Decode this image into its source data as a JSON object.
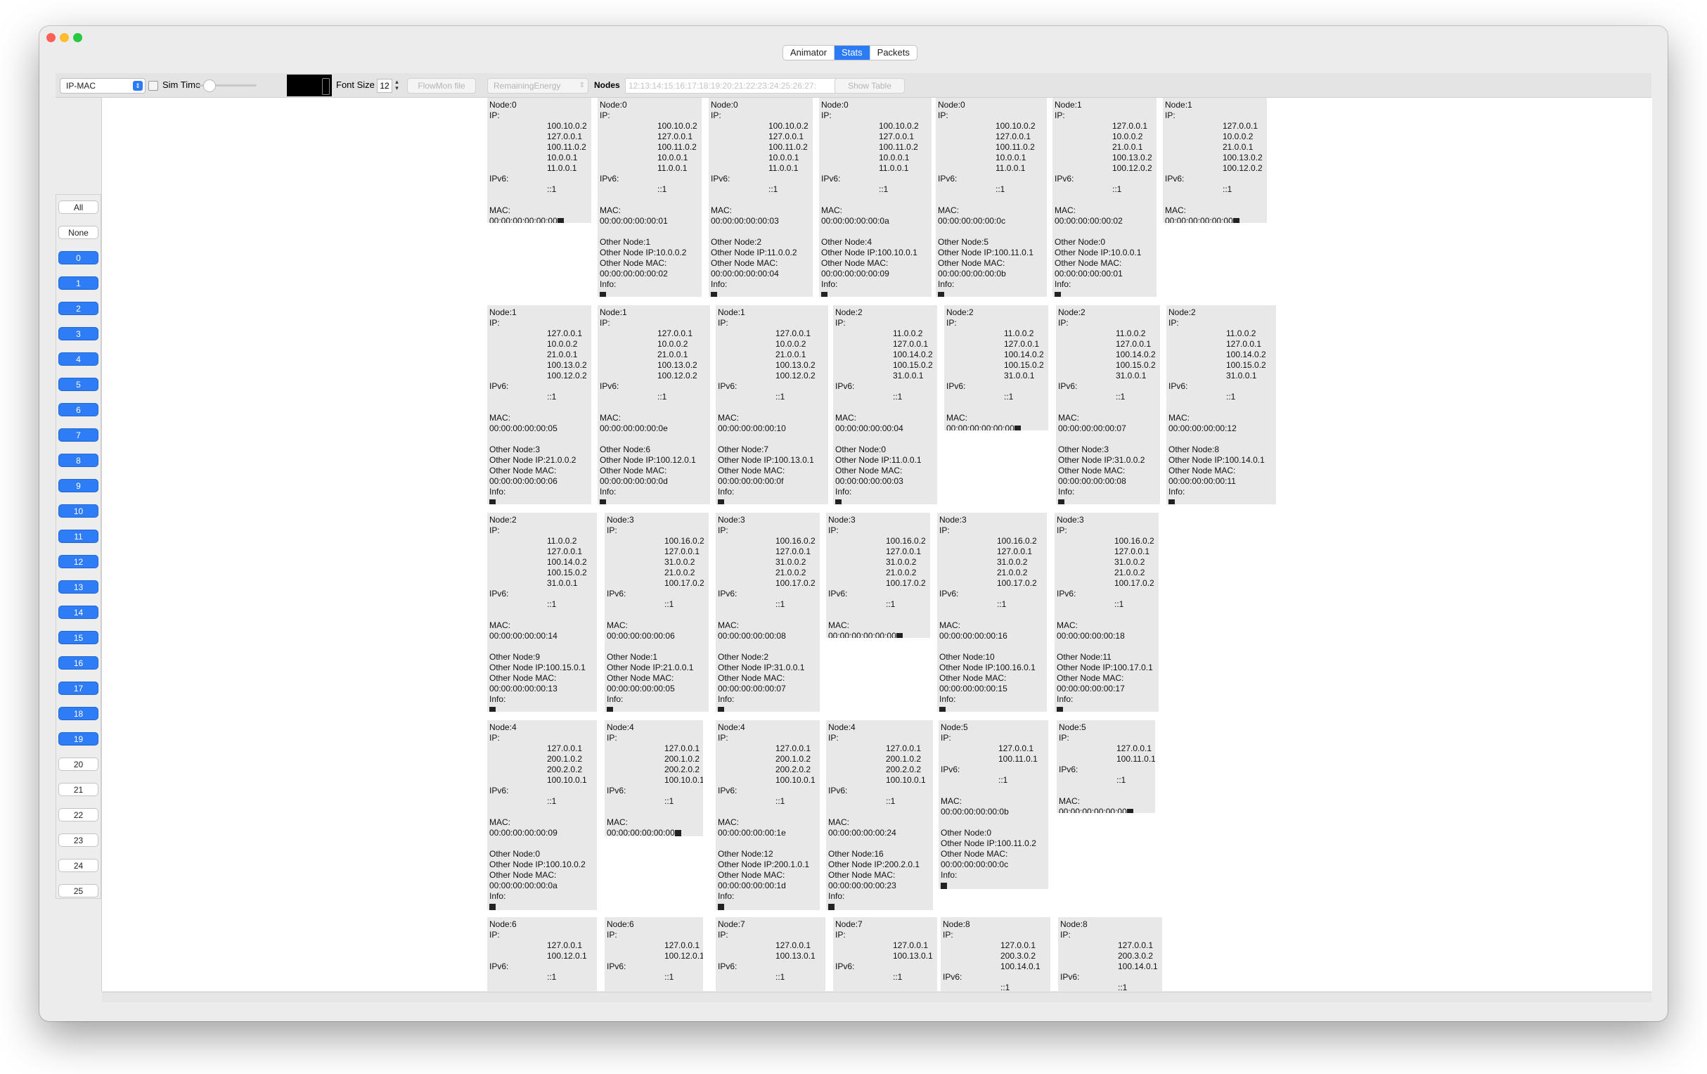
{
  "tabs": [
    {
      "label": "Animator",
      "active": false
    },
    {
      "label": "Stats",
      "active": true
    },
    {
      "label": "Packets",
      "active": false
    }
  ],
  "toolbar": {
    "mode_select": "IP-MAC",
    "sim_time_label": "Sim Time",
    "font_size_label": "Font Size",
    "font_size_value": "12",
    "flowmon_button": "FlowMon file",
    "energy_select": "RemainingEnergy",
    "nodes_label": "Nodes",
    "nodes_field": "12:13:14:15:16:17:18:19:20:21:22:23:24:25:26:27:",
    "show_table_button": "Show Table"
  },
  "sidebar": {
    "items": [
      {
        "label": "All",
        "selected": false
      },
      {
        "label": "None",
        "selected": false
      },
      {
        "label": "0",
        "selected": true
      },
      {
        "label": "1",
        "selected": true
      },
      {
        "label": "2",
        "selected": true
      },
      {
        "label": "3",
        "selected": true
      },
      {
        "label": "4",
        "selected": true
      },
      {
        "label": "5",
        "selected": true
      },
      {
        "label": "6",
        "selected": true
      },
      {
        "label": "7",
        "selected": true
      },
      {
        "label": "8",
        "selected": true
      },
      {
        "label": "9",
        "selected": true
      },
      {
        "label": "10",
        "selected": true
      },
      {
        "label": "11",
        "selected": true
      },
      {
        "label": "12",
        "selected": true
      },
      {
        "label": "13",
        "selected": true
      },
      {
        "label": "14",
        "selected": true
      },
      {
        "label": "15",
        "selected": true
      },
      {
        "label": "16",
        "selected": true
      },
      {
        "label": "17",
        "selected": true
      },
      {
        "label": "18",
        "selected": true
      },
      {
        "label": "19",
        "selected": true
      },
      {
        "label": "20",
        "selected": false
      },
      {
        "label": "21",
        "selected": false
      },
      {
        "label": "22",
        "selected": false
      },
      {
        "label": "23",
        "selected": false
      },
      {
        "label": "24",
        "selected": false
      },
      {
        "label": "25",
        "selected": false
      }
    ]
  },
  "cards": [
    {
      "node": "Node:0",
      "ips": [
        "100.10.0.2",
        "127.0.0.1",
        "100.11.0.2",
        "10.0.0.1",
        "11.0.0.1"
      ],
      "ipv6": "::1",
      "mac": "00:00:00:00:00:00",
      "other": null
    },
    {
      "node": "Node:0",
      "ips": [
        "100.10.0.2",
        "127.0.0.1",
        "100.11.0.2",
        "10.0.0.1",
        "11.0.0.1"
      ],
      "ipv6": "::1",
      "mac": "00:00:00:00:00:01",
      "other": {
        "node": "Other Node:1",
        "ip": "Other Node IP:10.0.0.2",
        "mac": "00:00:00:00:00:02"
      }
    },
    {
      "node": "Node:0",
      "ips": [
        "100.10.0.2",
        "127.0.0.1",
        "100.11.0.2",
        "10.0.0.1",
        "11.0.0.1"
      ],
      "ipv6": "::1",
      "mac": "00:00:00:00:00:03",
      "other": {
        "node": "Other Node:2",
        "ip": "Other Node IP:11.0.0.2",
        "mac": "00:00:00:00:00:04"
      }
    },
    {
      "node": "Node:0",
      "ips": [
        "100.10.0.2",
        "127.0.0.1",
        "100.11.0.2",
        "10.0.0.1",
        "11.0.0.1"
      ],
      "ipv6": "::1",
      "mac": "00:00:00:00:00:0a",
      "other": {
        "node": "Other Node:4",
        "ip": "Other Node IP:100.10.0.1",
        "mac": "00:00:00:00:00:09"
      }
    },
    {
      "node": "Node:0",
      "ips": [
        "100.10.0.2",
        "127.0.0.1",
        "100.11.0.2",
        "10.0.0.1",
        "11.0.0.1"
      ],
      "ipv6": "::1",
      "mac": "00:00:00:00:00:0c",
      "other": {
        "node": "Other Node:5",
        "ip": "Other Node IP:100.11.0.1",
        "mac": "00:00:00:00:00:0b"
      }
    },
    {
      "node": "Node:1",
      "ips": [
        "127.0.0.1",
        "10.0.0.2",
        "21.0.0.1",
        "100.13.0.2",
        "100.12.0.2"
      ],
      "ipv6": "::1",
      "mac": "00:00:00:00:00:02",
      "other": {
        "node": "Other Node:0",
        "ip": "Other Node IP:10.0.0.1",
        "mac": "00:00:00:00:00:01"
      }
    },
    {
      "node": "Node:1",
      "ips": [
        "127.0.0.1",
        "10.0.0.2",
        "21.0.0.1",
        "100.13.0.2",
        "100.12.0.2"
      ],
      "ipv6": "::1",
      "mac": "00:00:00:00:00:00",
      "other": null
    },
    {
      "node": "Node:1",
      "ips": [
        "127.0.0.1",
        "10.0.0.2",
        "21.0.0.1",
        "100.13.0.2",
        "100.12.0.2"
      ],
      "ipv6": "::1",
      "mac": "00:00:00:00:00:05",
      "other": {
        "node": "Other Node:3",
        "ip": "Other Node IP:21.0.0.2",
        "mac": "00:00:00:00:00:06"
      }
    },
    {
      "node": "Node:1",
      "ips": [
        "127.0.0.1",
        "10.0.0.2",
        "21.0.0.1",
        "100.13.0.2",
        "100.12.0.2"
      ],
      "ipv6": "::1",
      "mac": "00:00:00:00:00:0e",
      "other": {
        "node": "Other Node:6",
        "ip": "Other Node IP:100.12.0.1",
        "mac": "00:00:00:00:00:0d"
      }
    },
    {
      "node": "Node:1",
      "ips": [
        "127.0.0.1",
        "10.0.0.2",
        "21.0.0.1",
        "100.13.0.2",
        "100.12.0.2"
      ],
      "ipv6": "::1",
      "mac": "00:00:00:00:00:10",
      "other": {
        "node": "Other Node:7",
        "ip": "Other Node IP:100.13.0.1",
        "mac": "00:00:00:00:00:0f"
      }
    },
    {
      "node": "Node:2",
      "ips": [
        "11.0.0.2",
        "127.0.0.1",
        "100.14.0.2",
        "100.15.0.2",
        "31.0.0.1"
      ],
      "ipv6": "::1",
      "mac": "00:00:00:00:00:04",
      "other": {
        "node": "Other Node:0",
        "ip": "Other Node IP:11.0.0.1",
        "mac": "00:00:00:00:00:03"
      }
    },
    {
      "node": "Node:2",
      "ips": [
        "11.0.0.2",
        "127.0.0.1",
        "100.14.0.2",
        "100.15.0.2",
        "31.0.0.1"
      ],
      "ipv6": "::1",
      "mac": "00:00:00:00:00:00",
      "other": null
    },
    {
      "node": "Node:2",
      "ips": [
        "11.0.0.2",
        "127.0.0.1",
        "100.14.0.2",
        "100.15.0.2",
        "31.0.0.1"
      ],
      "ipv6": "::1",
      "mac": "00:00:00:00:00:07",
      "other": {
        "node": "Other Node:3",
        "ip": "Other Node IP:31.0.0.2",
        "mac": "00:00:00:00:00:08"
      }
    },
    {
      "node": "Node:2",
      "ips": [
        "11.0.0.2",
        "127.0.0.1",
        "100.14.0.2",
        "100.15.0.2",
        "31.0.0.1"
      ],
      "ipv6": "::1",
      "mac": "00:00:00:00:00:12",
      "other": {
        "node": "Other Node:8",
        "ip": "Other Node IP:100.14.0.1",
        "mac": "00:00:00:00:00:11"
      }
    },
    {
      "node": "Node:2",
      "ips": [
        "11.0.0.2",
        "127.0.0.1",
        "100.14.0.2",
        "100.15.0.2",
        "31.0.0.1"
      ],
      "ipv6": "::1",
      "mac": "00:00:00:00:00:14",
      "other": {
        "node": "Other Node:9",
        "ip": "Other Node IP:100.15.0.1",
        "mac": "00:00:00:00:00:13"
      }
    },
    {
      "node": "Node:3",
      "ips": [
        "100.16.0.2",
        "127.0.0.1",
        "31.0.0.2",
        "21.0.0.2",
        "100.17.0.2"
      ],
      "ipv6": "::1",
      "mac": "00:00:00:00:00:06",
      "other": {
        "node": "Other Node:1",
        "ip": "Other Node IP:21.0.0.1",
        "mac": "00:00:00:00:00:05"
      }
    },
    {
      "node": "Node:3",
      "ips": [
        "100.16.0.2",
        "127.0.0.1",
        "31.0.0.2",
        "21.0.0.2",
        "100.17.0.2"
      ],
      "ipv6": "::1",
      "mac": "00:00:00:00:00:08",
      "other": {
        "node": "Other Node:2",
        "ip": "Other Node IP:31.0.0.1",
        "mac": "00:00:00:00:00:07"
      }
    },
    {
      "node": "Node:3",
      "ips": [
        "100.16.0.2",
        "127.0.0.1",
        "31.0.0.2",
        "21.0.0.2",
        "100.17.0.2"
      ],
      "ipv6": "::1",
      "mac": "00:00:00:00:00:00",
      "other": null
    },
    {
      "node": "Node:3",
      "ips": [
        "100.16.0.2",
        "127.0.0.1",
        "31.0.0.2",
        "21.0.0.2",
        "100.17.0.2"
      ],
      "ipv6": "::1",
      "mac": "00:00:00:00:00:16",
      "other": {
        "node": "Other Node:10",
        "ip": "Other Node IP:100.16.0.1",
        "mac": "00:00:00:00:00:15"
      }
    },
    {
      "node": "Node:3",
      "ips": [
        "100.16.0.2",
        "127.0.0.1",
        "31.0.0.2",
        "21.0.0.2",
        "100.17.0.2"
      ],
      "ipv6": "::1",
      "mac": "00:00:00:00:00:18",
      "other": {
        "node": "Other Node:11",
        "ip": "Other Node IP:100.17.0.1",
        "mac": "00:00:00:00:00:17"
      }
    },
    {
      "node": "Node:4",
      "ips": [
        "127.0.0.1",
        "200.1.0.2",
        "200.2.0.2",
        "100.10.0.1"
      ],
      "ipv6": "::1",
      "mac": "00:00:00:00:00:09",
      "other": {
        "node": "Other Node:0",
        "ip": "Other Node IP:100.10.0.2",
        "mac": "00:00:00:00:00:0a"
      }
    },
    {
      "node": "Node:4",
      "ips": [
        "127.0.0.1",
        "200.1.0.2",
        "200.2.0.2",
        "100.10.0.1"
      ],
      "ipv6": "::1",
      "mac": "00:00:00:00:00:00",
      "other": null
    },
    {
      "node": "Node:4",
      "ips": [
        "127.0.0.1",
        "200.1.0.2",
        "200.2.0.2",
        "100.10.0.1"
      ],
      "ipv6": "::1",
      "mac": "00:00:00:00:00:1e",
      "other": {
        "node": "Other Node:12",
        "ip": "Other Node IP:200.1.0.1",
        "mac": "00:00:00:00:00:1d"
      }
    },
    {
      "node": "Node:4",
      "ips": [
        "127.0.0.1",
        "200.1.0.2",
        "200.2.0.2",
        "100.10.0.1"
      ],
      "ipv6": "::1",
      "mac": "00:00:00:00:00:24",
      "other": {
        "node": "Other Node:16",
        "ip": "Other Node IP:200.2.0.1",
        "mac": "00:00:00:00:00:23"
      }
    },
    {
      "node": "Node:5",
      "ips": [
        "127.0.0.1",
        "100.11.0.1"
      ],
      "ipv6": "::1",
      "mac": "00:00:00:00:00:0b",
      "other": {
        "node": "Other Node:0",
        "ip": "Other Node IP:100.11.0.2",
        "mac": "00:00:00:00:00:0c"
      }
    },
    {
      "node": "Node:5",
      "ips": [
        "127.0.0.1",
        "100.11.0.1"
      ],
      "ipv6": "::1",
      "mac": "00:00:00:00:00:00",
      "other": null
    },
    {
      "node": "Node:6",
      "ips": [
        "127.0.0.1",
        "100.12.0.1"
      ],
      "ipv6": "::1",
      "mac": "",
      "other": null
    },
    {
      "node": "Node:6",
      "ips": [
        "127.0.0.1",
        "100.12.0.1"
      ],
      "ipv6": "::1",
      "mac": "",
      "other": null
    },
    {
      "node": "Node:7",
      "ips": [
        "127.0.0.1",
        "100.13.0.1"
      ],
      "ipv6": "::1",
      "mac": "",
      "other": null
    },
    {
      "node": "Node:7",
      "ips": [
        "127.0.0.1",
        "100.13.0.1"
      ],
      "ipv6": "::1",
      "mac": "",
      "other": null
    },
    {
      "node": "Node:8",
      "ips": [
        "127.0.0.1",
        "200.3.0.2",
        "100.14.0.1"
      ],
      "ipv6": "::1",
      "mac": "",
      "other": null
    },
    {
      "node": "Node:8",
      "ips": [
        "127.0.0.1",
        "200.3.0.2",
        "100.14.0.1"
      ],
      "ipv6": "::1",
      "mac": "",
      "other": null
    }
  ]
}
